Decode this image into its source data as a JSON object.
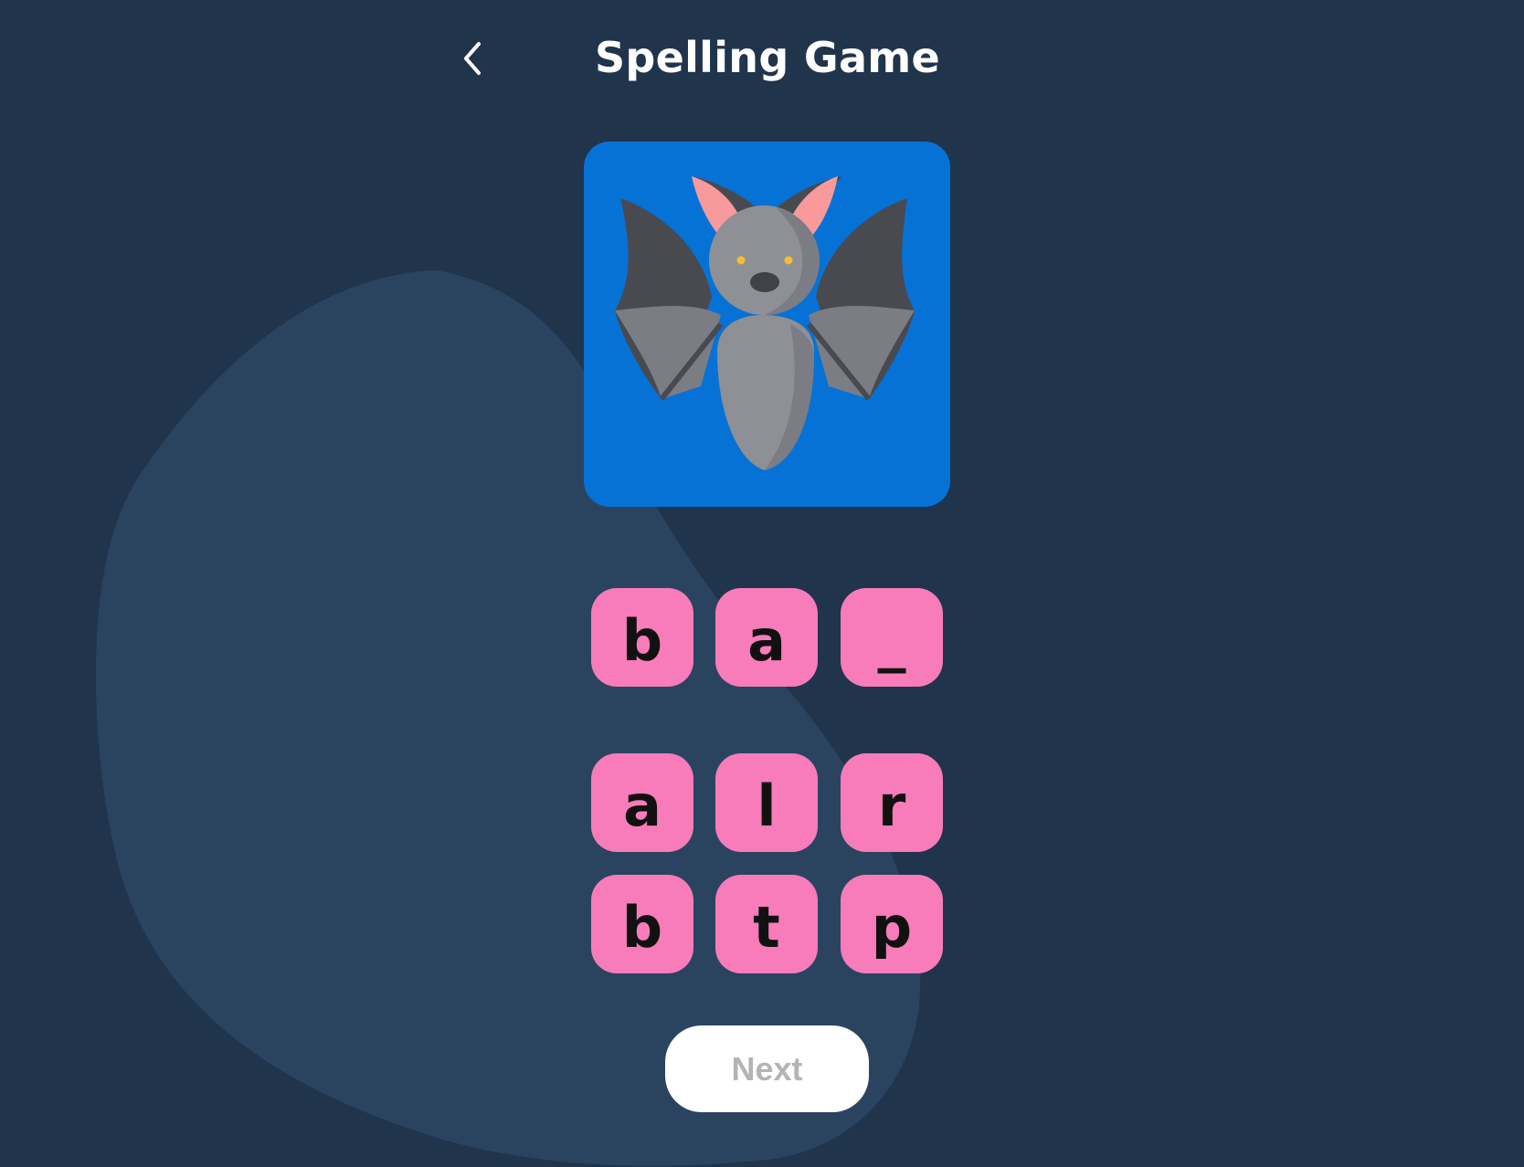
{
  "header": {
    "title": "Spelling Game",
    "back_icon": "chevron-left-icon"
  },
  "picture": {
    "subject_icon": "bat-icon",
    "card_color": "#0672d5"
  },
  "answer_slots": [
    "b",
    "a",
    "_"
  ],
  "letter_choices": {
    "row1": [
      "a",
      "l",
      "r"
    ],
    "row2": [
      "b",
      "t",
      "p"
    ]
  },
  "next_button": {
    "label": "Next",
    "state": "disabled"
  },
  "colors": {
    "background": "#20344c",
    "blob": "#2a4460",
    "tile": "#f87cba",
    "title_text": "#ffffff",
    "next_text": "#b4b4b4"
  }
}
